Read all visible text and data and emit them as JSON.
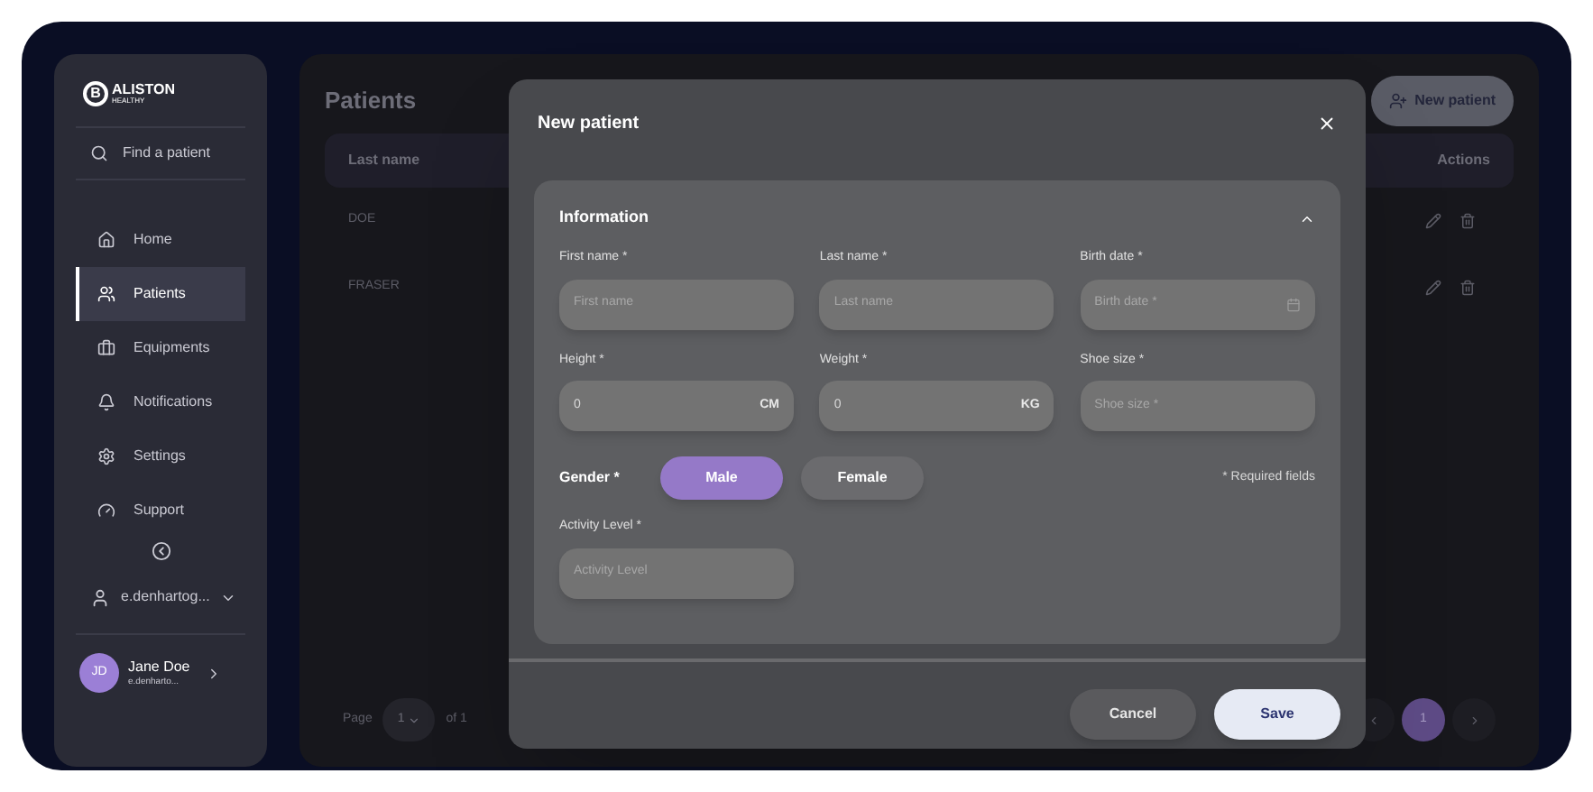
{
  "sidebar": {
    "logo": {
      "mark": "B",
      "name": "ALISTON",
      "tagline": "HEALTHY"
    },
    "search": {
      "placeholder": "Find a patient"
    },
    "items": [
      {
        "label": "Home",
        "selected": false
      },
      {
        "label": "Patients",
        "selected": true
      },
      {
        "label": "Equipments",
        "selected": false
      },
      {
        "label": "Notifications",
        "selected": false
      },
      {
        "label": "Settings",
        "selected": false
      },
      {
        "label": "Support",
        "selected": false
      }
    ],
    "account": {
      "username": "e.denhartog..."
    },
    "profile": {
      "initials": "JD",
      "name": "Jane Doe",
      "email": "e.denharto..."
    }
  },
  "main": {
    "title": "Patients",
    "new_button": "New patient",
    "columns": [
      "Last name",
      "Actions"
    ],
    "rows": [
      {
        "last_name": "DOE"
      },
      {
        "last_name": "FRASER"
      }
    ],
    "pagination": {
      "label": "Page",
      "page": "1",
      "total": "of 1"
    },
    "pages": [
      {
        "label": "1",
        "selected": true
      }
    ]
  },
  "modal": {
    "title": "New patient",
    "section": {
      "title": "Information",
      "expanded": true
    },
    "fields": [
      {
        "kind": "text",
        "label": "First name *",
        "placeholder": "First name"
      },
      {
        "kind": "text",
        "label": "Last name *",
        "placeholder": "Last name"
      },
      {
        "kind": "date",
        "label": "Birth date *",
        "placeholder": "Birth date *"
      },
      {
        "kind": "number",
        "label": "Height *",
        "value": "0",
        "unit": "CM"
      },
      {
        "kind": "number",
        "label": "Weight *",
        "value": "0",
        "unit": "KG"
      },
      {
        "kind": "text",
        "label": "Shoe size *",
        "placeholder": "Shoe size *"
      }
    ],
    "gender": {
      "label": "Gender *",
      "options": [
        {
          "label": "Male",
          "selected": true
        },
        {
          "label": "Female",
          "selected": false
        }
      ]
    },
    "required_note": "* Required fields",
    "activity": {
      "label": "Activity Level *",
      "placeholder": "Activity Level"
    },
    "buttons": [
      {
        "kind": "secondary",
        "label": "Cancel"
      },
      {
        "kind": "primary",
        "label": "Save"
      }
    ]
  }
}
